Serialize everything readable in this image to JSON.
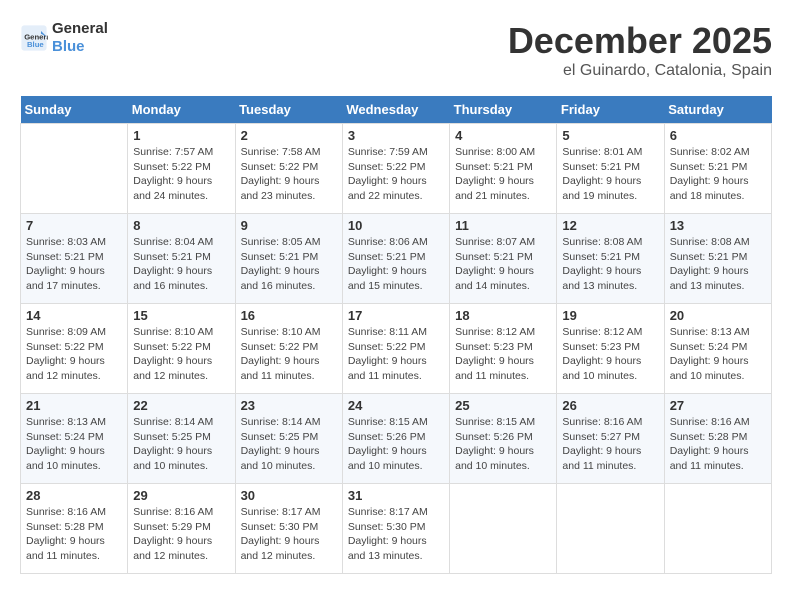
{
  "logo": {
    "line1": "General",
    "line2": "Blue"
  },
  "header": {
    "month": "December 2025",
    "location": "el Guinardo, Catalonia, Spain"
  },
  "weekdays": [
    "Sunday",
    "Monday",
    "Tuesday",
    "Wednesday",
    "Thursday",
    "Friday",
    "Saturday"
  ],
  "weeks": [
    [
      {
        "day": "",
        "info": ""
      },
      {
        "day": "1",
        "info": "Sunrise: 7:57 AM\nSunset: 5:22 PM\nDaylight: 9 hours\nand 24 minutes."
      },
      {
        "day": "2",
        "info": "Sunrise: 7:58 AM\nSunset: 5:22 PM\nDaylight: 9 hours\nand 23 minutes."
      },
      {
        "day": "3",
        "info": "Sunrise: 7:59 AM\nSunset: 5:22 PM\nDaylight: 9 hours\nand 22 minutes."
      },
      {
        "day": "4",
        "info": "Sunrise: 8:00 AM\nSunset: 5:21 PM\nDaylight: 9 hours\nand 21 minutes."
      },
      {
        "day": "5",
        "info": "Sunrise: 8:01 AM\nSunset: 5:21 PM\nDaylight: 9 hours\nand 19 minutes."
      },
      {
        "day": "6",
        "info": "Sunrise: 8:02 AM\nSunset: 5:21 PM\nDaylight: 9 hours\nand 18 minutes."
      }
    ],
    [
      {
        "day": "7",
        "info": "Sunrise: 8:03 AM\nSunset: 5:21 PM\nDaylight: 9 hours\nand 17 minutes."
      },
      {
        "day": "8",
        "info": "Sunrise: 8:04 AM\nSunset: 5:21 PM\nDaylight: 9 hours\nand 16 minutes."
      },
      {
        "day": "9",
        "info": "Sunrise: 8:05 AM\nSunset: 5:21 PM\nDaylight: 9 hours\nand 16 minutes."
      },
      {
        "day": "10",
        "info": "Sunrise: 8:06 AM\nSunset: 5:21 PM\nDaylight: 9 hours\nand 15 minutes."
      },
      {
        "day": "11",
        "info": "Sunrise: 8:07 AM\nSunset: 5:21 PM\nDaylight: 9 hours\nand 14 minutes."
      },
      {
        "day": "12",
        "info": "Sunrise: 8:08 AM\nSunset: 5:21 PM\nDaylight: 9 hours\nand 13 minutes."
      },
      {
        "day": "13",
        "info": "Sunrise: 8:08 AM\nSunset: 5:21 PM\nDaylight: 9 hours\nand 13 minutes."
      }
    ],
    [
      {
        "day": "14",
        "info": "Sunrise: 8:09 AM\nSunset: 5:22 PM\nDaylight: 9 hours\nand 12 minutes."
      },
      {
        "day": "15",
        "info": "Sunrise: 8:10 AM\nSunset: 5:22 PM\nDaylight: 9 hours\nand 12 minutes."
      },
      {
        "day": "16",
        "info": "Sunrise: 8:10 AM\nSunset: 5:22 PM\nDaylight: 9 hours\nand 11 minutes."
      },
      {
        "day": "17",
        "info": "Sunrise: 8:11 AM\nSunset: 5:22 PM\nDaylight: 9 hours\nand 11 minutes."
      },
      {
        "day": "18",
        "info": "Sunrise: 8:12 AM\nSunset: 5:23 PM\nDaylight: 9 hours\nand 11 minutes."
      },
      {
        "day": "19",
        "info": "Sunrise: 8:12 AM\nSunset: 5:23 PM\nDaylight: 9 hours\nand 10 minutes."
      },
      {
        "day": "20",
        "info": "Sunrise: 8:13 AM\nSunset: 5:24 PM\nDaylight: 9 hours\nand 10 minutes."
      }
    ],
    [
      {
        "day": "21",
        "info": "Sunrise: 8:13 AM\nSunset: 5:24 PM\nDaylight: 9 hours\nand 10 minutes."
      },
      {
        "day": "22",
        "info": "Sunrise: 8:14 AM\nSunset: 5:25 PM\nDaylight: 9 hours\nand 10 minutes."
      },
      {
        "day": "23",
        "info": "Sunrise: 8:14 AM\nSunset: 5:25 PM\nDaylight: 9 hours\nand 10 minutes."
      },
      {
        "day": "24",
        "info": "Sunrise: 8:15 AM\nSunset: 5:26 PM\nDaylight: 9 hours\nand 10 minutes."
      },
      {
        "day": "25",
        "info": "Sunrise: 8:15 AM\nSunset: 5:26 PM\nDaylight: 9 hours\nand 10 minutes."
      },
      {
        "day": "26",
        "info": "Sunrise: 8:16 AM\nSunset: 5:27 PM\nDaylight: 9 hours\nand 11 minutes."
      },
      {
        "day": "27",
        "info": "Sunrise: 8:16 AM\nSunset: 5:28 PM\nDaylight: 9 hours\nand 11 minutes."
      }
    ],
    [
      {
        "day": "28",
        "info": "Sunrise: 8:16 AM\nSunset: 5:28 PM\nDaylight: 9 hours\nand 11 minutes."
      },
      {
        "day": "29",
        "info": "Sunrise: 8:16 AM\nSunset: 5:29 PM\nDaylight: 9 hours\nand 12 minutes."
      },
      {
        "day": "30",
        "info": "Sunrise: 8:17 AM\nSunset: 5:30 PM\nDaylight: 9 hours\nand 12 minutes."
      },
      {
        "day": "31",
        "info": "Sunrise: 8:17 AM\nSunset: 5:30 PM\nDaylight: 9 hours\nand 13 minutes."
      },
      {
        "day": "",
        "info": ""
      },
      {
        "day": "",
        "info": ""
      },
      {
        "day": "",
        "info": ""
      }
    ]
  ]
}
